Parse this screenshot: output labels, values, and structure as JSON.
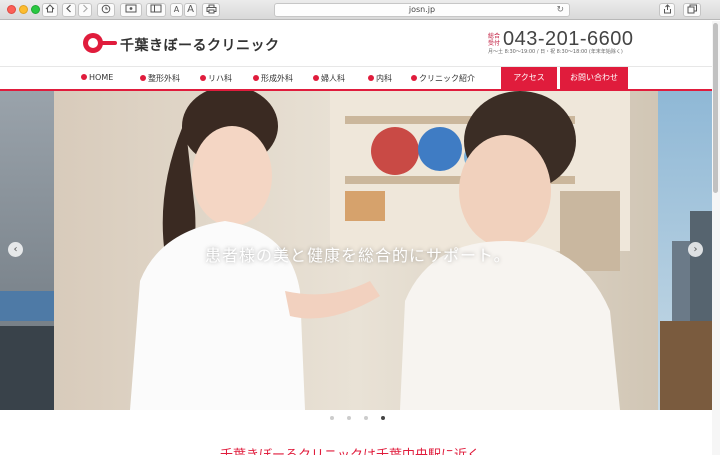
{
  "browser": {
    "url": "josn.jp",
    "reload_icon": "reload-icon"
  },
  "header": {
    "logo_text": "千葉きぼーるクリニック",
    "tel_label": "総合受付",
    "tel_number": "043-201-6600",
    "tel_hours": "月〜土 8:30〜19:00 / 日・祝 8:30〜18:00 (年末年始除く)"
  },
  "nav": {
    "items": [
      {
        "label": "HOME"
      },
      {
        "label": "整形外科"
      },
      {
        "label": "リハ科"
      },
      {
        "label": "形成外科"
      },
      {
        "label": "婦人科"
      },
      {
        "label": "内科"
      },
      {
        "label": "クリニック紹介"
      }
    ],
    "access_label": "アクセス",
    "contact_label": "お問い合わせ"
  },
  "hero": {
    "caption": "患者様の美と健康を総合的にサポート。",
    "prev_label": "‹",
    "next_label": "›",
    "slide_count": 4,
    "active_slide": 4
  },
  "lead": {
    "text": "千葉きぼーるクリニックは千葉中央駅に近く"
  },
  "colors": {
    "accent": "#e01c3c"
  }
}
